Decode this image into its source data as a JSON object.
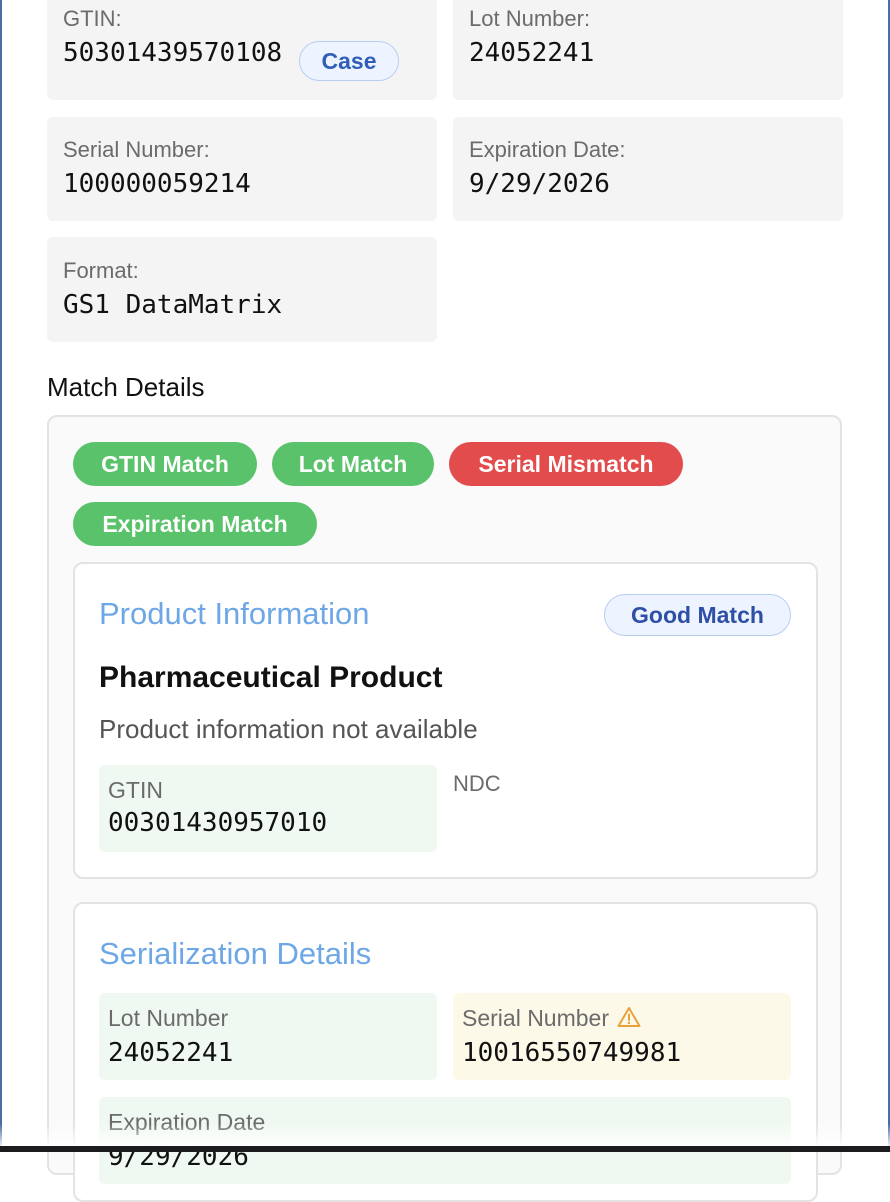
{
  "scan_fields": {
    "gtin_label": "GTIN:",
    "gtin_value": "50301439570108",
    "package_level": "Case",
    "lot_label": "Lot Number:",
    "lot_value": "24052241",
    "serial_label": "Serial Number:",
    "serial_value": "100000059214",
    "expiration_label": "Expiration Date:",
    "expiration_value": "9/29/2026",
    "format_label": "Format:",
    "format_value": "GS1 DataMatrix"
  },
  "match_details": {
    "title": "Match Details",
    "tags": [
      {
        "label": "GTIN Match",
        "status": "match"
      },
      {
        "label": "Lot Match",
        "status": "match"
      },
      {
        "label": "Serial Mismatch",
        "status": "mismatch"
      },
      {
        "label": "Expiration Match",
        "status": "match"
      }
    ]
  },
  "product_info": {
    "title": "Product Information",
    "match_badge": "Good Match",
    "name": "Pharmaceutical Product",
    "description": "Product information not available",
    "gtin_label": "GTIN",
    "gtin_value": "00301430957010",
    "ndc_label": "NDC"
  },
  "serialization": {
    "title": "Serialization Details",
    "lot_label": "Lot Number",
    "lot_value": "24052241",
    "serial_label": "Serial Number",
    "serial_value": "10016550749981",
    "serial_warning_icon": "warning-triangle-icon",
    "expiration_label": "Expiration Date",
    "expiration_value": "9/29/2026"
  },
  "colors": {
    "match_green": "#5ac26a",
    "mismatch_red": "#e24c4c",
    "title_blue": "#6ea7e6",
    "warning_orange": "#e8a23a"
  }
}
